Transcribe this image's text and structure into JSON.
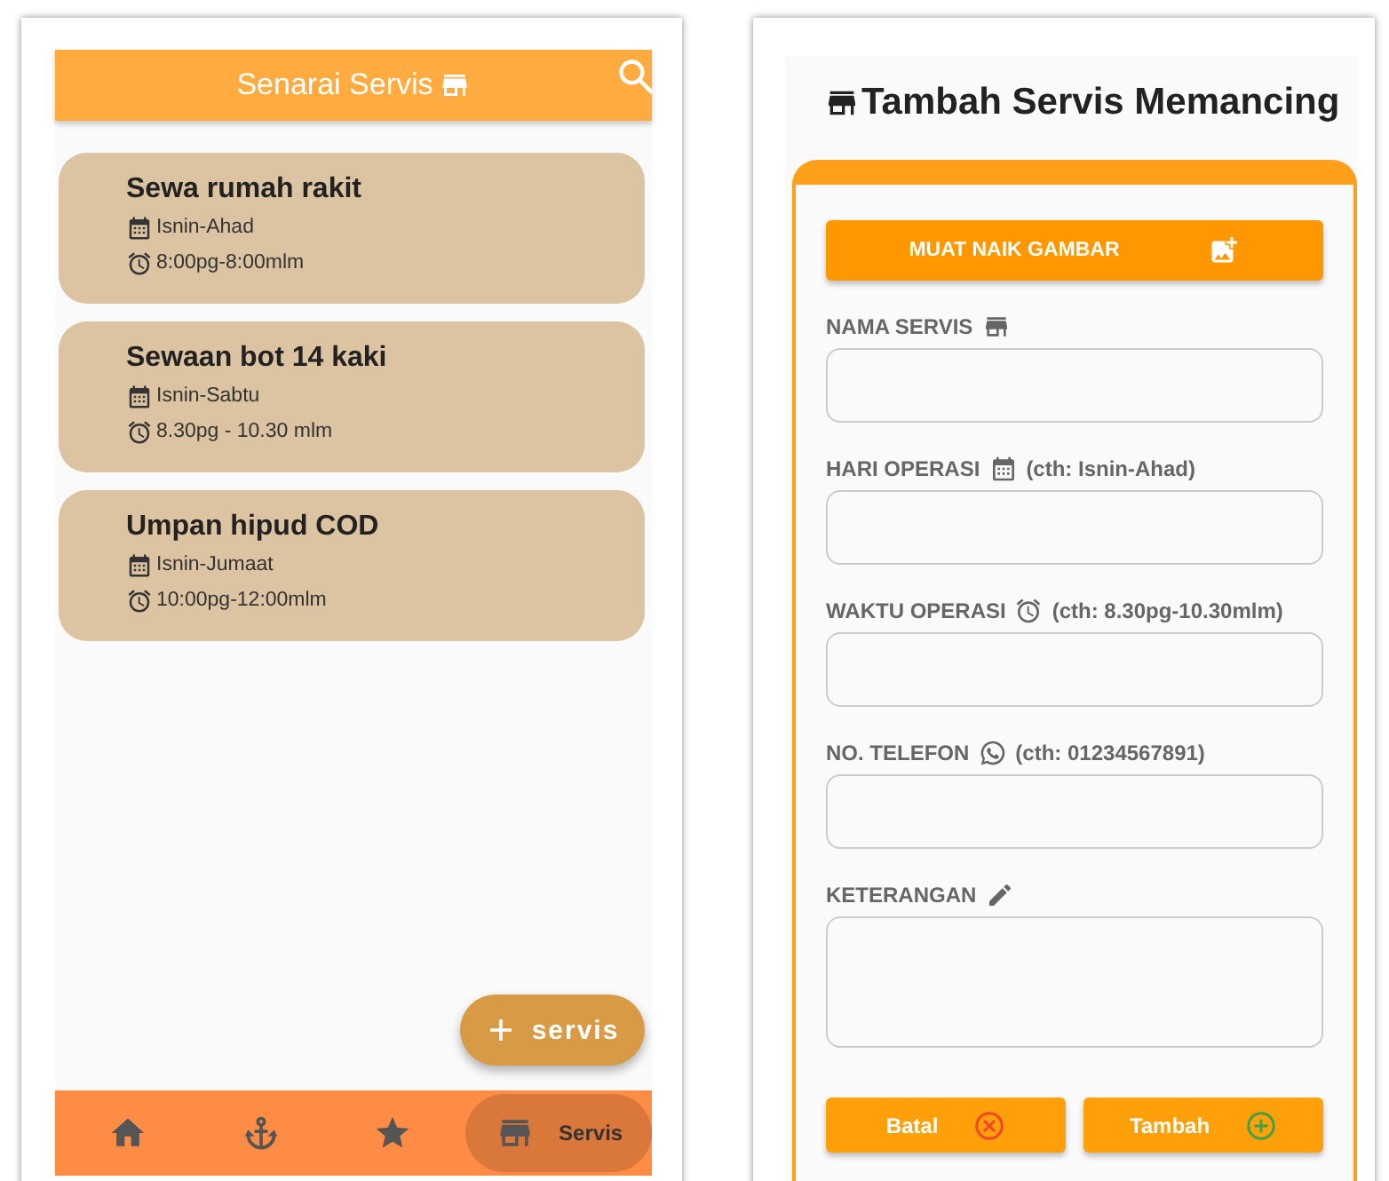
{
  "list_screen": {
    "header": {
      "title": "Senarai Servis"
    },
    "services": [
      {
        "name": "Sewa rumah rakit",
        "days": "Isnin-Ahad",
        "hours": "8:00pg-8:00mlm"
      },
      {
        "name": "Sewaan bot 14 kaki",
        "days": "Isnin-Sabtu",
        "hours": "8.30pg - 10.30 mlm"
      },
      {
        "name": "Umpan hipud COD",
        "days": "Isnin-Jumaat",
        "hours": "10:00pg-12:00mlm"
      }
    ],
    "fab": {
      "label": "servis"
    },
    "bottom_nav": [
      {
        "kind": "home",
        "selected": false
      },
      {
        "kind": "anchor",
        "selected": false
      },
      {
        "kind": "star",
        "selected": false
      },
      {
        "kind": "store",
        "selected": true,
        "label": "Servis"
      }
    ]
  },
  "form_screen": {
    "title": "Tambah Servis Memancing",
    "upload_button": "MUAT NAIK GAMBAR",
    "fields": [
      {
        "kind": "name",
        "label": "NAMA SERVIS",
        "multiline": false
      },
      {
        "kind": "days",
        "label": "HARI OPERASI",
        "hint": "(cth: Isnin-Ahad)",
        "multiline": false
      },
      {
        "kind": "time",
        "label": "WAKTU OPERASI",
        "hint": "(cth: 8.30pg-10.30mlm)",
        "multiline": false
      },
      {
        "kind": "phone",
        "label": "NO. TELEFON",
        "hint": "(cth: 01234567891)",
        "multiline": false
      },
      {
        "kind": "notes",
        "label": "KETERANGAN",
        "multiline": true
      }
    ],
    "buttons": [
      {
        "kind": "cancel",
        "label": "Batal"
      },
      {
        "kind": "add",
        "label": "Tambah"
      }
    ]
  }
}
